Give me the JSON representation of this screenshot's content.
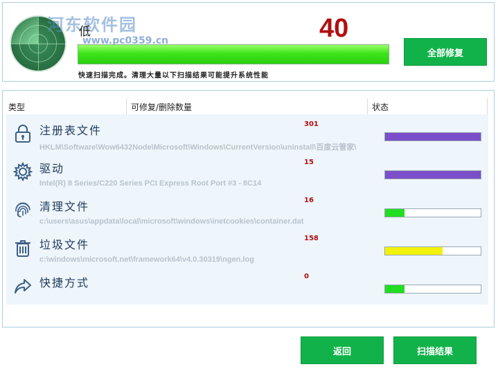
{
  "header": {
    "level_label": "低",
    "score": "40",
    "score_progress": 1.0,
    "scan_message": "快速扫描完成。清理大量以下扫描结果可能提升系统性能",
    "fix_all_label": "全部修复",
    "watermark_text": "河东软件园",
    "watermark_url": "www.pc0359.cn"
  },
  "columns": {
    "type": "类型",
    "count": "可修复/删除数量",
    "status": "状态"
  },
  "items": [
    {
      "name": "注册表文件",
      "icon": "lock-icon",
      "count": "301",
      "path": "HKLM\\Software\\Wow6432Node\\Microsoft\\Windows\\CurrentVersion\\uninstall\\百度云管家\\",
      "status_progress": 1.0,
      "status_color": "#7b4fc9"
    },
    {
      "name": "驱动",
      "icon": "gear-icon",
      "count": "15",
      "path": "Intel(R) 8 Series/C220 Series PCI Express Root Port #3 - 8C14",
      "status_progress": 1.0,
      "status_color": "#7b4fc9"
    },
    {
      "name": "清理文件",
      "icon": "fingerprint-icon",
      "count": "16",
      "path": "c:\\users\\asus\\appdata\\local\\microsoft\\windows\\inetcookies\\container.dat",
      "status_progress": 0.2,
      "status_color": "#22dd22"
    },
    {
      "name": "垃圾文件",
      "icon": "trash-icon",
      "count": "158",
      "path": "c:\\windows\\microsoft.net\\framework64\\v4.0.30319\\ngen.log",
      "status_progress": 0.6,
      "status_color": "#f2f20a"
    },
    {
      "name": "快捷方式",
      "icon": "share-arrow-icon",
      "count": "0",
      "path": "",
      "status_progress": 0.2,
      "status_color": "#22dd22"
    }
  ],
  "footer": {
    "back_label": "返回",
    "scan_result_label": "扫描结果"
  }
}
